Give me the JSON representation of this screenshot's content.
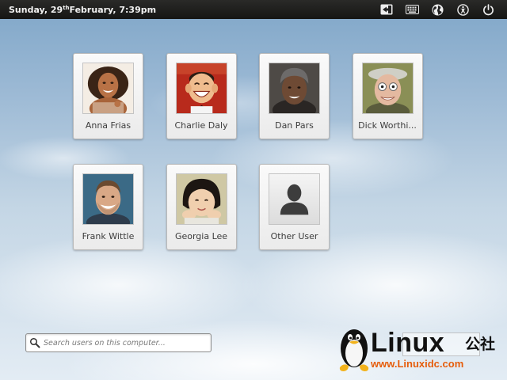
{
  "topbar": {
    "clock": {
      "date_prefix": "Sunday, 29",
      "day_suffix": "th",
      "date_rest": " February, 7:39pm"
    },
    "indicators": [
      {
        "icon": "session-icon"
      },
      {
        "icon": "keyboard-icon"
      },
      {
        "icon": "network-globe-icon"
      },
      {
        "icon": "accessibility-icon"
      },
      {
        "icon": "power-icon"
      }
    ]
  },
  "users": [
    {
      "name": "Anna Frias"
    },
    {
      "name": "Charlie Daly"
    },
    {
      "name": "Dan Pars"
    },
    {
      "name": "Dick Worthi..."
    },
    {
      "name": "Frank Wittle"
    },
    {
      "name": "Georgia Lee"
    },
    {
      "name": "Other User"
    }
  ],
  "search": {
    "placeholder": "Search users on this computer...",
    "value": ""
  },
  "watermark": {
    "word": "Linux",
    "cn": "公社",
    "url": "www.Linuxidc.com"
  },
  "colors": {
    "panel": "#1e1e1c",
    "watermark_url": "#e65c0a"
  }
}
